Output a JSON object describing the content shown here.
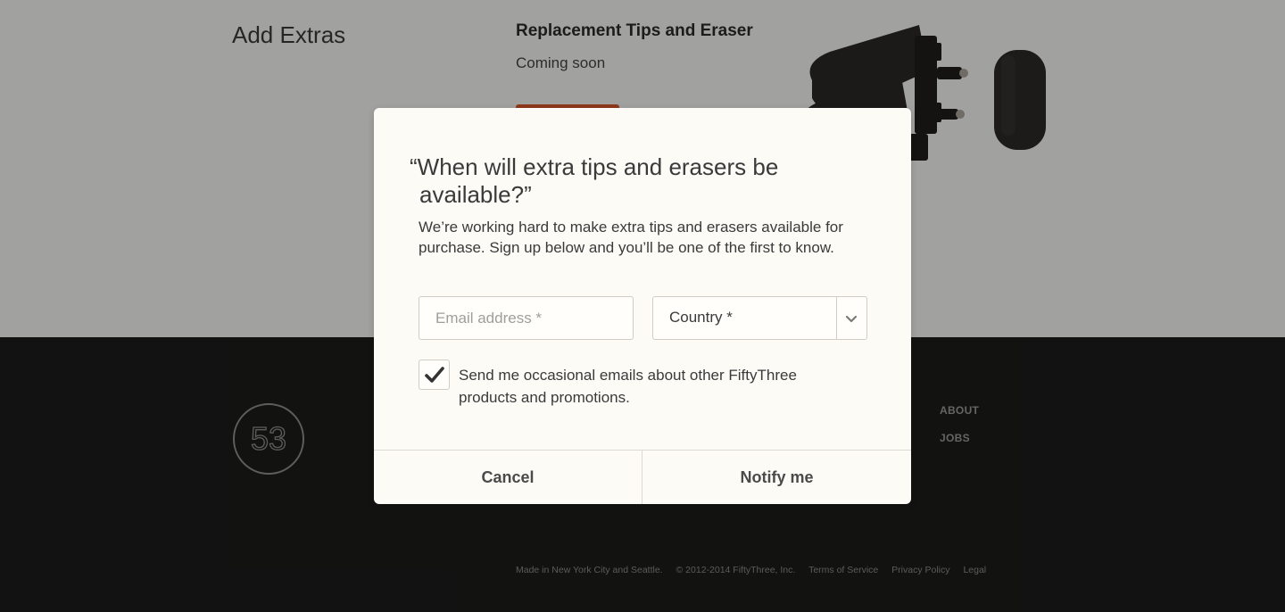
{
  "page": {
    "extras_title": "Add Extras",
    "product": {
      "name": "Replacement Tips and Eraser",
      "status": "Coming soon"
    }
  },
  "footer": {
    "logo_text": "53",
    "links": [
      "ABOUT",
      "JOBS"
    ],
    "bottom": {
      "made_in": "Made in New York City and Seattle.",
      "copyright": "© 2012-2014 FiftyThree, Inc.",
      "terms": "Terms of Service",
      "privacy": "Privacy Policy",
      "legal": "Legal"
    }
  },
  "modal": {
    "title": "“When will extra tips and erasers be available?”",
    "body": "We’re working hard to make extra tips and erasers available for purchase. Sign up below and you’ll be one of the first to know.",
    "email": {
      "value": "",
      "placeholder": "Email address *"
    },
    "country": {
      "selected": "Country *"
    },
    "optin": {
      "checked": true,
      "label": "Send me occasional emails about other FiftyThree products and promotions."
    },
    "buttons": {
      "cancel": "Cancel",
      "notify": "Notify me"
    }
  },
  "colors": {
    "accent": "#d9542b",
    "footer_bg": "#1c1c1b",
    "modal_bg": "#fcfbf6",
    "page_bg": "#f4f4f2"
  },
  "icons": [
    "chevron-down-icon",
    "check-icon",
    "fiftythree-logo"
  ]
}
